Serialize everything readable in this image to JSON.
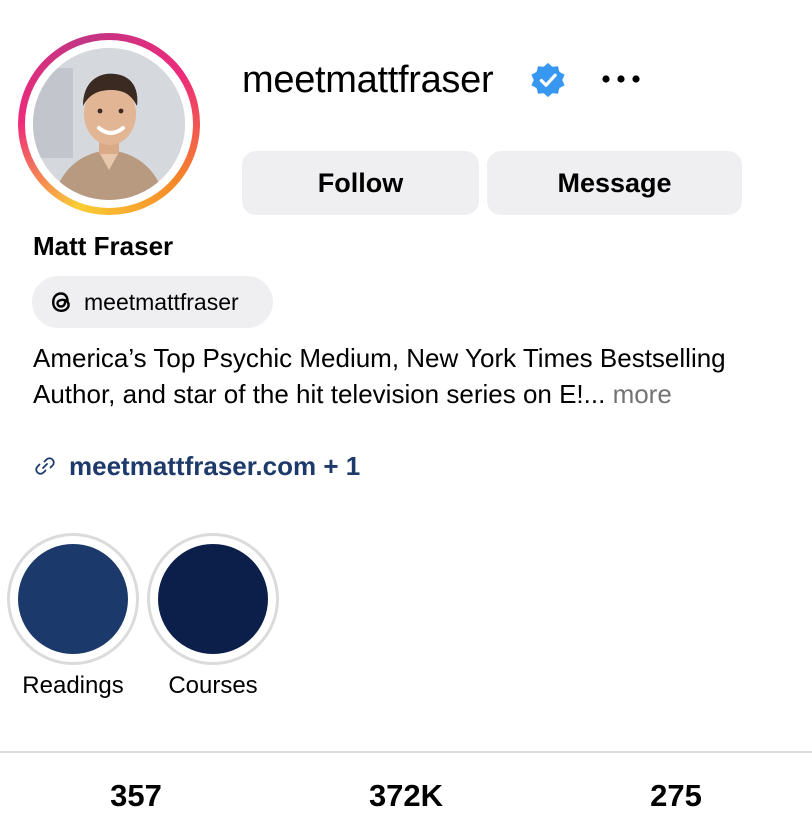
{
  "profile": {
    "username": "meetmattfraser",
    "display_name": "Matt Fraser",
    "verified_icon": "verified-badge-icon",
    "more_icon": "more-options-icon"
  },
  "actions": {
    "follow_label": "Follow",
    "message_label": "Message"
  },
  "threads": {
    "handle": "meetmattfraser",
    "icon": "threads-icon"
  },
  "bio": {
    "text": "America’s Top Psychic Medium, New York Times Bestselling Author, and star of the hit television series on E!...",
    "more_label": "more"
  },
  "link": {
    "icon": "link-icon",
    "text": "meetmattfraser.com + 1"
  },
  "highlights": [
    {
      "label": "Readings",
      "color": "#1b3a6b"
    },
    {
      "label": "Courses",
      "color": "#0b1f4a"
    }
  ],
  "stats": [
    {
      "value": "357"
    },
    {
      "value": "372K"
    },
    {
      "value": "275"
    }
  ],
  "colors": {
    "verified_blue": "#3897f0",
    "link_blue": "#1e3a6b",
    "button_bg": "#efeff1"
  }
}
